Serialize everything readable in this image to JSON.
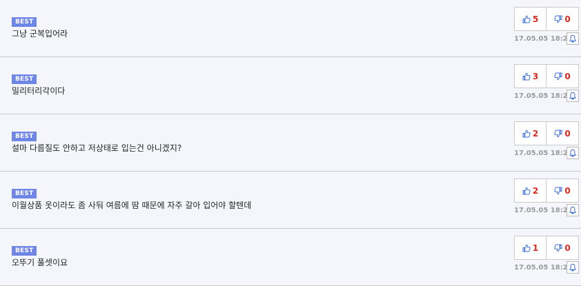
{
  "colors": {
    "badge_bg": "#6f86e6",
    "count_red": "#e2231a",
    "icon_blue": "#3b6fd8",
    "date_gray": "#9a9a9a",
    "row_bg": "#f5f6fb"
  },
  "icons": {
    "like": "thumbs-up-icon",
    "dislike": "thumbs-down-icon",
    "report": "bell-icon"
  },
  "comments": [
    {
      "badge": "BEST",
      "text": "그냥 군복입어라",
      "likes": "5",
      "dislikes": "0",
      "date": "17.05.05 18:21"
    },
    {
      "badge": "BEST",
      "text": "밀리터리각이다",
      "likes": "3",
      "dislikes": "0",
      "date": "17.05.05 18:21"
    },
    {
      "badge": "BEST",
      "text": "설마 다름질도 안하고 저상태로 입는건 아니겠지?",
      "likes": "2",
      "dislikes": "0",
      "date": "17.05.05 18:21"
    },
    {
      "badge": "BEST",
      "text": "이월상품 옷이라도 좀 사둬 여름에 땀 때문에 자주 갈아 입어야 할텐데",
      "likes": "2",
      "dislikes": "0",
      "date": "17.05.05 18:21"
    },
    {
      "badge": "BEST",
      "text": "오뚜기 풀셋이요",
      "likes": "1",
      "dislikes": "0",
      "date": "17.05.05 18:21"
    }
  ]
}
